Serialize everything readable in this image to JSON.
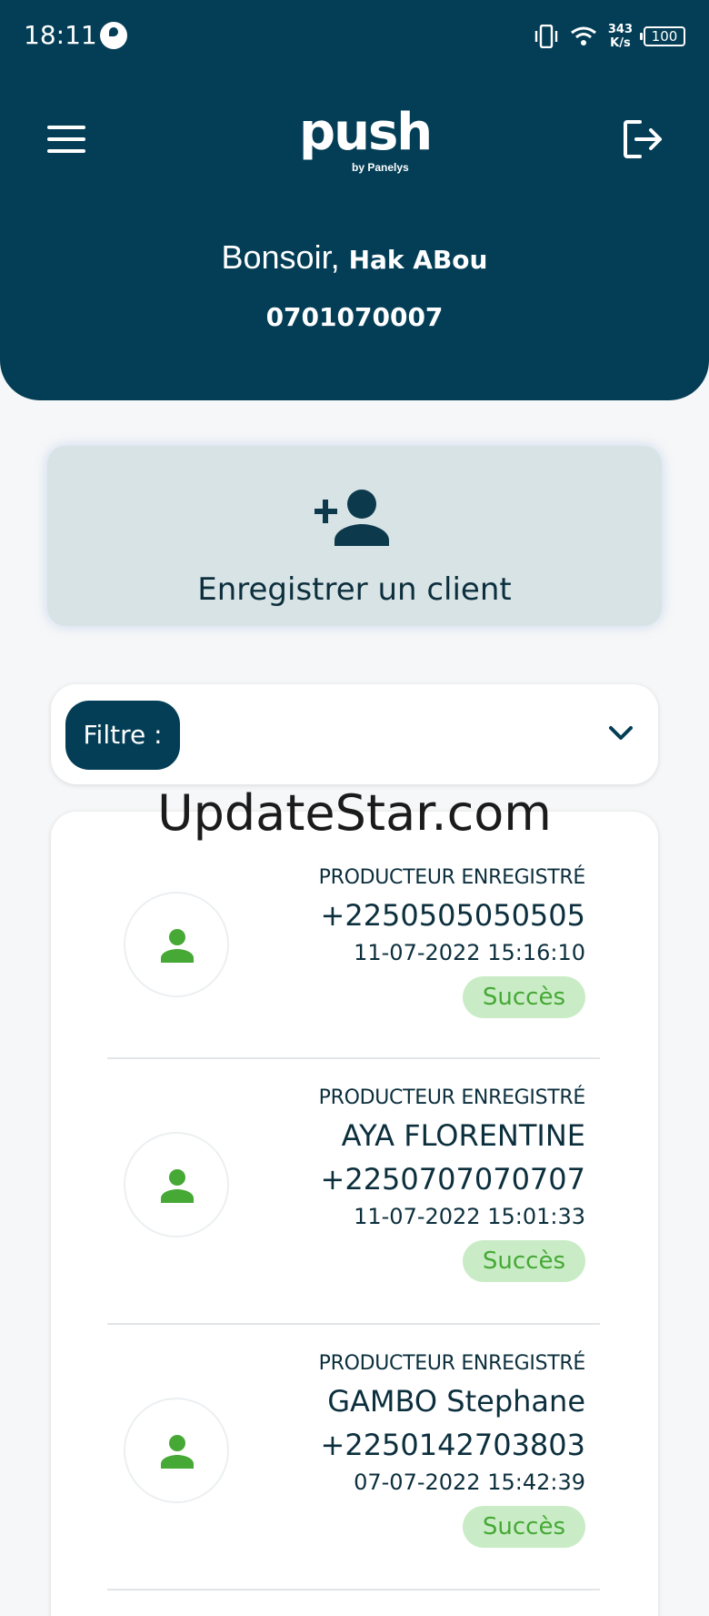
{
  "status_bar": {
    "time": "18:11",
    "speed_value": "343",
    "speed_unit": "K/s",
    "battery": "100"
  },
  "header": {
    "logo_text": "push",
    "logo_subtext": "by Panelys",
    "greeting_prefix": "Bonsoir,",
    "user_name": "Hak ABou",
    "phone": "0701070007",
    "colors": {
      "header_bg": "#033e56"
    }
  },
  "register": {
    "label": "Enregistrer un client",
    "icon": "add-user-icon"
  },
  "filter": {
    "label": "Filtre :",
    "icon": "chevron-down-icon"
  },
  "watermark": "UpdateStar.com",
  "records": [
    {
      "type": "PRODUCTEUR ENREGISTRÉ",
      "name": "",
      "phone": "+2250505050505",
      "date": "11-07-2022 15:16:10",
      "status": "Succès"
    },
    {
      "type": "PRODUCTEUR ENREGISTRÉ",
      "name": "AYA FLORENTINE",
      "phone": "+2250707070707",
      "date": "11-07-2022 15:01:33",
      "status": "Succès"
    },
    {
      "type": "PRODUCTEUR ENREGISTRÉ",
      "name": "GAMBO Stephane",
      "phone": "+2250142703803",
      "date": "07-07-2022 15:42:39",
      "status": "Succès"
    }
  ],
  "colors": {
    "success_bg": "#c9ecc6",
    "success_text": "#46a835",
    "avatar_icon": "#46a835"
  }
}
